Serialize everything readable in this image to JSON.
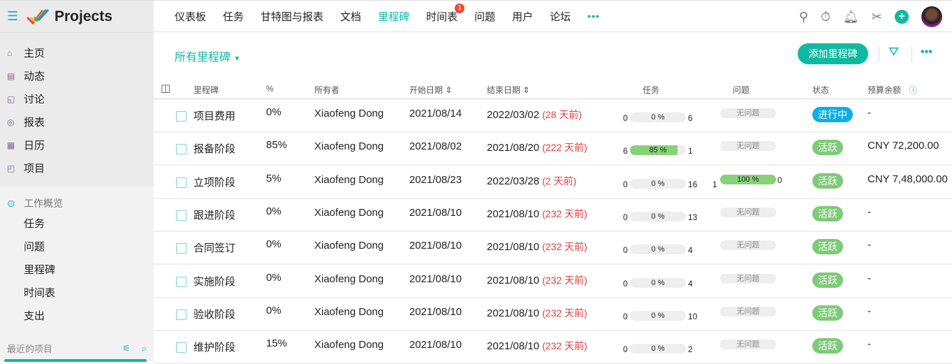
{
  "app": {
    "title": "Projects"
  },
  "sidebar": {
    "items": [
      {
        "label": "主页",
        "icon": "home-icon"
      },
      {
        "label": "动态",
        "icon": "feed-icon"
      },
      {
        "label": "讨论",
        "icon": "discussion-icon"
      },
      {
        "label": "报表",
        "icon": "reports-icon"
      },
      {
        "label": "日历",
        "icon": "calendar-icon"
      },
      {
        "label": "项目",
        "icon": "briefcase-icon"
      }
    ],
    "section": {
      "title": "工作概览",
      "items": [
        "任务",
        "问题",
        "里程碑",
        "时间表",
        "支出"
      ]
    },
    "recent": "最近的项目"
  },
  "topnav": {
    "tabs": [
      {
        "label": "仪表板"
      },
      {
        "label": "任务"
      },
      {
        "label": "甘特图与报表"
      },
      {
        "label": "文档"
      },
      {
        "label": "里程碑",
        "active": true
      },
      {
        "label": "时间表",
        "badge": "1"
      },
      {
        "label": "问题"
      },
      {
        "label": "用户"
      },
      {
        "label": "论坛"
      }
    ],
    "more": "•••"
  },
  "toolbar": {
    "filter": "所有里程碑",
    "add": "添加里程碑",
    "more": "•••"
  },
  "colors": {
    "accent": "#11b9a2",
    "in_progress": "#0aaee8",
    "active": "#7dcb76",
    "overdue": "#e04040"
  },
  "table": {
    "headers": [
      "里程碑",
      "%",
      "所有者",
      "开始日期",
      "结束日期",
      "任务",
      "问题",
      "状态",
      "预算余额"
    ],
    "rows": [
      {
        "name": "项目费用",
        "pct": "0%",
        "owner": "Xiaofeng Dong",
        "start": "2021/08/14",
        "end": "2022/03/02",
        "overdue": "(28 天前)",
        "t_open": "0",
        "t_pct": 0,
        "t_label": "0 %",
        "t_closed": "6",
        "issues": "无问题",
        "status": "进行中",
        "status_type": "in_progress",
        "budget": "-"
      },
      {
        "name": "报备阶段",
        "pct": "85%",
        "owner": "Xiaofeng Dong",
        "start": "2021/08/02",
        "end": "2021/08/20",
        "overdue": "(222 天前)",
        "t_open": "6",
        "t_pct": 85,
        "t_label": "85 %",
        "t_closed": "1",
        "issues": "无问题",
        "status": "活跃",
        "status_type": "active",
        "budget": "CNY 72,200.00"
      },
      {
        "name": "立项阶段",
        "pct": "5%",
        "owner": "Xiaofeng Dong",
        "start": "2021/08/23",
        "end": "2022/03/28",
        "overdue": "(2 天前)",
        "t_open": "0",
        "t_pct": 0,
        "t_label": "0 %",
        "t_closed": "16",
        "i_open": "1",
        "i_pct": 100,
        "i_label": "100 %",
        "i_closed": "0",
        "status": "活跃",
        "status_type": "active",
        "budget": "CNY 7,48,000.00"
      },
      {
        "name": "跟进阶段",
        "pct": "0%",
        "owner": "Xiaofeng Dong",
        "start": "2021/08/10",
        "end": "2021/08/10",
        "overdue": "(232 天前)",
        "t_open": "0",
        "t_pct": 0,
        "t_label": "0 %",
        "t_closed": "13",
        "issues": "无问题",
        "status": "活跃",
        "status_type": "active",
        "budget": "-"
      },
      {
        "name": "合同签订",
        "pct": "0%",
        "owner": "Xiaofeng Dong",
        "start": "2021/08/10",
        "end": "2021/08/10",
        "overdue": "(232 天前)",
        "t_open": "0",
        "t_pct": 0,
        "t_label": "0 %",
        "t_closed": "4",
        "issues": "无问题",
        "status": "活跃",
        "status_type": "active",
        "budget": "-"
      },
      {
        "name": "实施阶段",
        "pct": "0%",
        "owner": "Xiaofeng Dong",
        "start": "2021/08/10",
        "end": "2021/08/10",
        "overdue": "(232 天前)",
        "t_open": "0",
        "t_pct": 0,
        "t_label": "0 %",
        "t_closed": "4",
        "issues": "无问题",
        "status": "活跃",
        "status_type": "active",
        "budget": "-"
      },
      {
        "name": "验收阶段",
        "pct": "0%",
        "owner": "Xiaofeng Dong",
        "start": "2021/08/10",
        "end": "2021/08/10",
        "overdue": "(232 天前)",
        "t_open": "0",
        "t_pct": 0,
        "t_label": "0 %",
        "t_closed": "10",
        "issues": "无问题",
        "status": "活跃",
        "status_type": "active",
        "budget": "-"
      },
      {
        "name": "维护阶段",
        "pct": "15%",
        "owner": "Xiaofeng Dong",
        "start": "2021/08/10",
        "end": "2021/08/10",
        "overdue": "(232 天前)",
        "t_open": "0",
        "t_pct": 0,
        "t_label": "0 %",
        "t_closed": "2",
        "issues": "无问题",
        "status": "活跃",
        "status_type": "active",
        "budget": "-"
      }
    ]
  }
}
